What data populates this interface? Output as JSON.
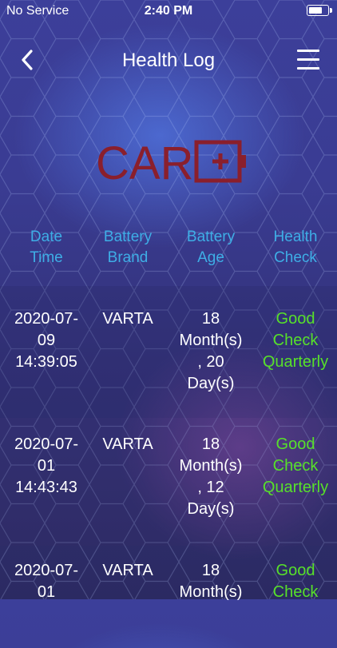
{
  "status_bar": {
    "carrier": "No Service",
    "time": "2:40 PM"
  },
  "nav": {
    "title": "Health Log",
    "back_icon": "chevron-left-icon",
    "menu_icon": "hamburger-menu-icon"
  },
  "logo": {
    "text": "CAR",
    "brand_color": "#8a1f2c"
  },
  "table": {
    "headers": [
      {
        "line1": "Date",
        "line2": "Time"
      },
      {
        "line1": "Battery",
        "line2": "Brand"
      },
      {
        "line1": "Battery",
        "line2": "Age"
      },
      {
        "line1": "Health",
        "line2": "Check"
      }
    ],
    "header_color": "#3eaee6",
    "status_color": "#57e02a",
    "rows": [
      {
        "date": [
          "2020-07-",
          "09",
          "14:39:05"
        ],
        "brand": "VARTA",
        "age": [
          "18",
          "Month(s)",
          ", 20",
          "Day(s)"
        ],
        "health": [
          "Good",
          "Check",
          "Quarterly"
        ]
      },
      {
        "date": [
          "2020-07-",
          "01",
          "14:43:43"
        ],
        "brand": "VARTA",
        "age": [
          "18",
          "Month(s)",
          ", 12",
          "Day(s)"
        ],
        "health": [
          "Good",
          "Check",
          "Quarterly"
        ]
      },
      {
        "date": [
          "2020-07-",
          "01"
        ],
        "brand": "VARTA",
        "age": [
          "18",
          "Month(s)"
        ],
        "health": [
          "Good",
          "Check"
        ]
      }
    ]
  }
}
